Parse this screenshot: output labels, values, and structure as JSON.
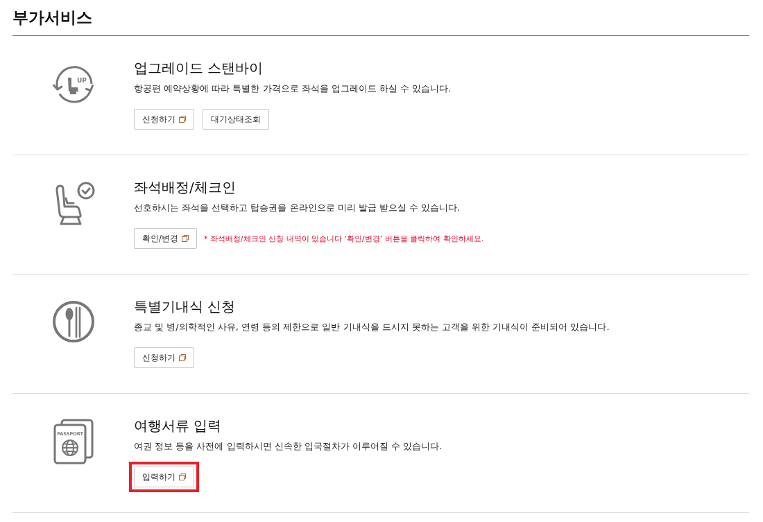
{
  "page_title": "부가서비스",
  "sections": [
    {
      "kind": "upgrade",
      "icon_text": "UP",
      "title": "업그레이드 스탠바이",
      "description": "항공편 예약상황에 따라 특별한 가격으로 좌석을 업그레이드 하실 수 있습니다.",
      "buttons": [
        {
          "label": "신청하기",
          "popup": true,
          "highlighted": false
        },
        {
          "label": "대기상태조회",
          "popup": false,
          "highlighted": false
        }
      ]
    },
    {
      "kind": "seat-check",
      "title": "좌석배정/체크인",
      "description": "선호하시는 좌석을 선택하고 탑승권을 온라인으로 미리 발급 받으실 수 있습니다.",
      "buttons": [
        {
          "label": "확인/변경",
          "popup": true,
          "highlighted": false
        }
      ],
      "note": "* 좌석배정/체크인 신청 내역이 있습니다 ‘확인/변경’ 버튼을 클릭하여 확인하세요."
    },
    {
      "kind": "meal",
      "title": "특별기내식 신청",
      "description": "종교 및 병/의학적인 사유, 연령 등의 제한으로 일반 기내식을 드시지 못하는 고객을 위한 기내식이 준비되어 있습니다.",
      "buttons": [
        {
          "label": "신청하기",
          "popup": true,
          "highlighted": false
        }
      ]
    },
    {
      "kind": "passport",
      "icon_text": "PASSPORT",
      "title": "여행서류 입력",
      "description": "여권 정보 등을 사전에 입력하시면 신속한 입국절차가 이루어질 수 있습니다.",
      "buttons": [
        {
          "label": "입력하기",
          "popup": true,
          "highlighted": true
        }
      ]
    }
  ]
}
